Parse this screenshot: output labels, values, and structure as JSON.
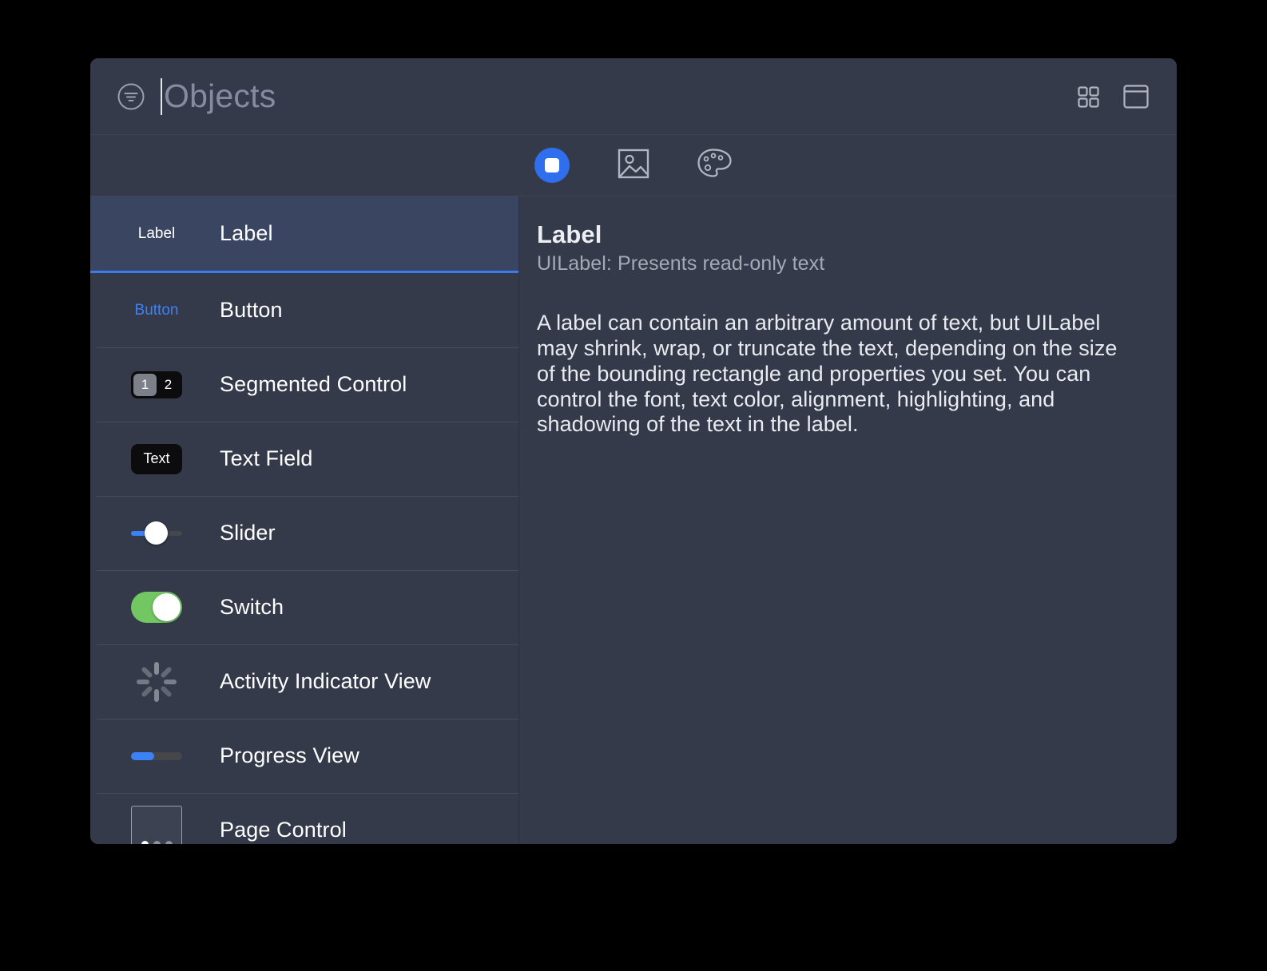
{
  "window": {
    "titlebar": {
      "filter_icon": "filter-circle-icon",
      "search_value": "",
      "search_placeholder": "Objects",
      "actions": [
        {
          "name": "grid-view-icon",
          "label": "Grid View"
        },
        {
          "name": "detail-view-icon",
          "label": "Detail View"
        }
      ]
    },
    "tabs": [
      {
        "name": "tab-objects",
        "icon": "filled-square-circle-icon",
        "label": "Objects",
        "selected": true
      },
      {
        "name": "tab-media",
        "icon": "image-icon",
        "label": "Media",
        "selected": false
      },
      {
        "name": "tab-colors",
        "icon": "palette-icon",
        "label": "Colors",
        "selected": false
      }
    ]
  },
  "list": {
    "items": [
      {
        "label": "Label",
        "preview": "label-preview",
        "preview_text": "Label",
        "selected": true
      },
      {
        "label": "Button",
        "preview": "button-preview",
        "preview_text": "Button",
        "selected": false
      },
      {
        "label": "Segmented Control",
        "preview": "segmented-preview",
        "segments": [
          "1",
          "2"
        ],
        "selected": false
      },
      {
        "label": "Text Field",
        "preview": "textfield-preview",
        "preview_text": "Text",
        "selected": false
      },
      {
        "label": "Slider",
        "preview": "slider-preview",
        "selected": false
      },
      {
        "label": "Switch",
        "preview": "switch-preview",
        "selected": false
      },
      {
        "label": "Activity Indicator View",
        "preview": "activity-indicator-preview",
        "selected": false
      },
      {
        "label": "Progress View",
        "preview": "progress-preview",
        "selected": false
      },
      {
        "label": "Page Control",
        "preview": "pagecontrol-preview",
        "selected": false
      }
    ]
  },
  "detail": {
    "title": "Label",
    "subtitle": "UILabel: Presents read-only text",
    "description": "A label can contain an arbitrary amount of text, but UILabel may shrink, wrap, or truncate the text, depending on the size of the bounding rectangle and properties you set. You can control the font, text color, alignment, highlighting, and shadowing of the text in the label."
  },
  "colors": {
    "window_background": "#343a4a",
    "selected_row": "#3a4661",
    "accent_blue": "#3b7cf5",
    "switch_green": "#73c762",
    "page_background": "#000000"
  }
}
